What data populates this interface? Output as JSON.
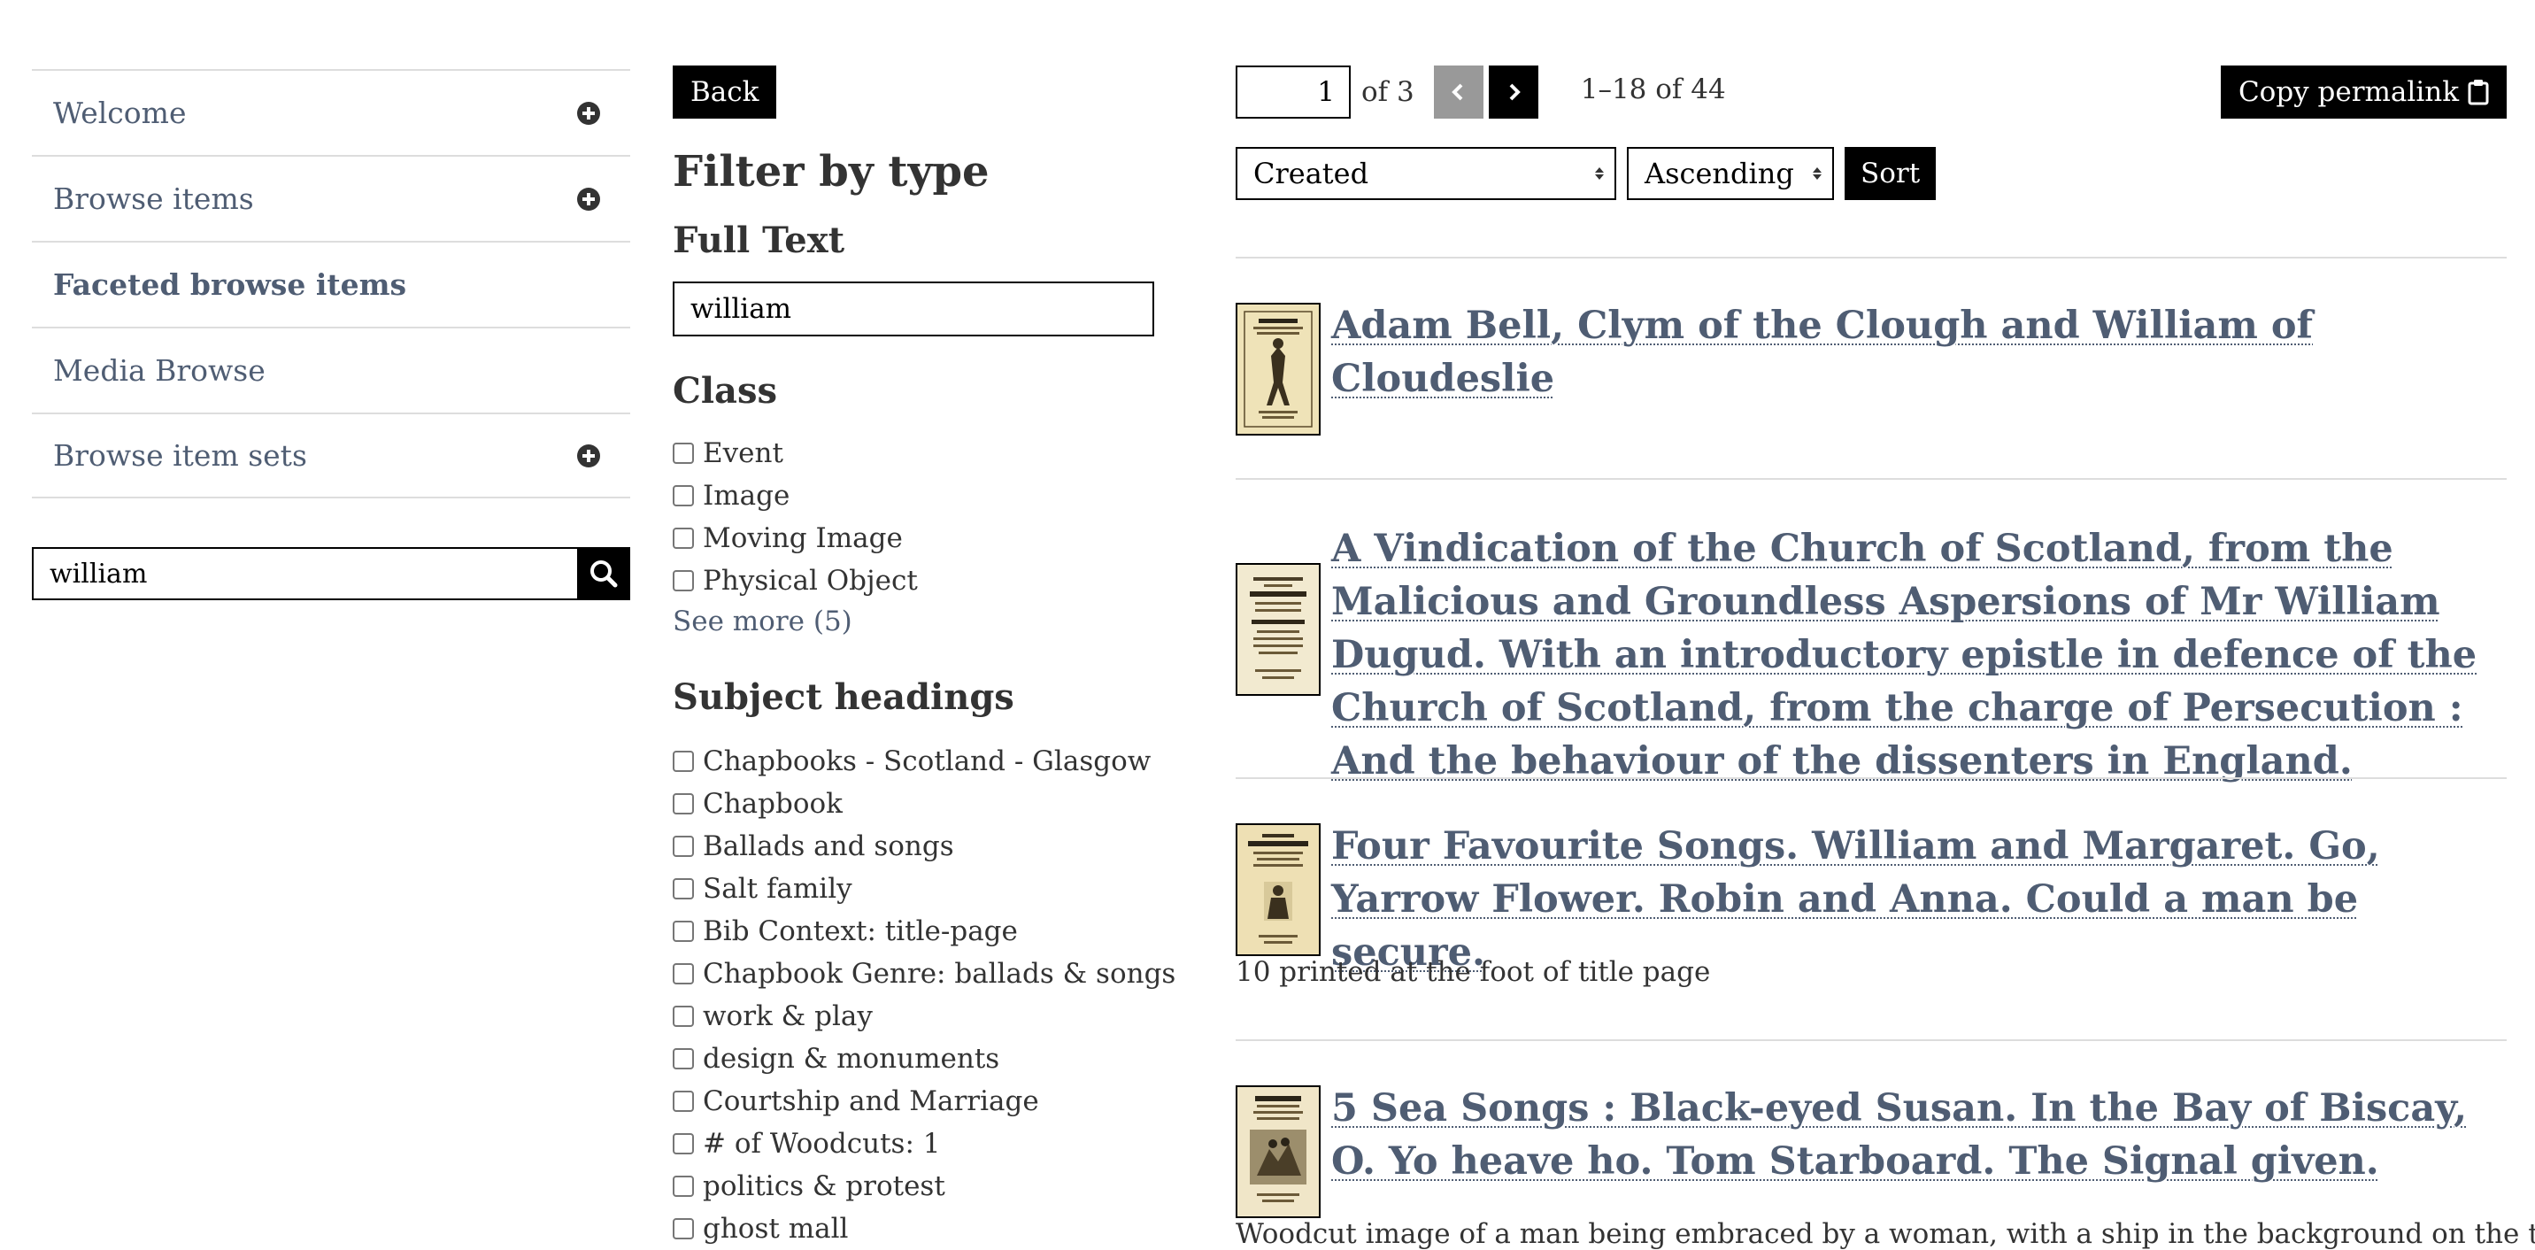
{
  "nav": {
    "items": [
      {
        "label": "Welcome",
        "expandable": true
      },
      {
        "label": "Browse items",
        "expandable": true
      },
      {
        "label": "Faceted browse items",
        "expandable": false,
        "active": true
      },
      {
        "label": "Media Browse",
        "expandable": false
      },
      {
        "label": "Browse item sets",
        "expandable": true
      }
    ],
    "search_value": "william",
    "search_icon": "search-icon"
  },
  "facets": {
    "back_label": "Back",
    "title": "Filter by type",
    "fulltext_heading": "Full Text",
    "fulltext_value": "william",
    "class_heading": "Class",
    "class_options": [
      "Event",
      "Image",
      "Moving Image",
      "Physical Object"
    ],
    "see_more": "See more (5)",
    "subject_heading": "Subject headings",
    "subject_options": [
      "Chapbooks - Scotland - Glasgow",
      "Chapbook",
      "Ballads and songs",
      "Salt family",
      "Bib Context: title-page",
      "Chapbook Genre: ballads & songs",
      "work & play",
      "design & monuments",
      "Courtship and Marriage",
      "# of Woodcuts: 1",
      "politics & protest",
      "ghost mall"
    ]
  },
  "pagination": {
    "page_value": "1",
    "of_pages": "of 3",
    "prev_icon": "chevron-left-icon",
    "next_icon": "chevron-right-icon",
    "range": "1–18 of 44"
  },
  "permalink": {
    "label": "Copy permalink",
    "icon": "clipboard-icon"
  },
  "sort": {
    "by_value": "Created",
    "order_value": "Ascending",
    "button_label": "Sort"
  },
  "results": [
    {
      "title": "Adam Bell, Clym of the Clough and William of Cloudeslie",
      "description": ""
    },
    {
      "title": "A Vindication of the Church of Scotland, from the Malicious and Groundless Aspersions of Mr William Dugud. With an introductory epistle in defence of the Church of Scotland, from the charge of Persecution : And the behaviour of the dissenters in England.",
      "description": ""
    },
    {
      "title": "Four Favourite Songs. William and Margaret. Go, Yarrow Flower. Robin and Anna. Could a man be secure.",
      "description": "10 printed at the foot of title page"
    },
    {
      "title": "5 Sea Songs : Black-eyed Susan. In the Bay of Biscay, O. Yo heave ho. Tom Starboard. The Signal given.",
      "description": "Woodcut image of a man being embraced by a woman, with a ship in the background on the title-"
    }
  ],
  "colors": {
    "link": "#4f5d73",
    "button": "#000000",
    "disabled_button": "#999999",
    "divider": "#dddddd"
  }
}
